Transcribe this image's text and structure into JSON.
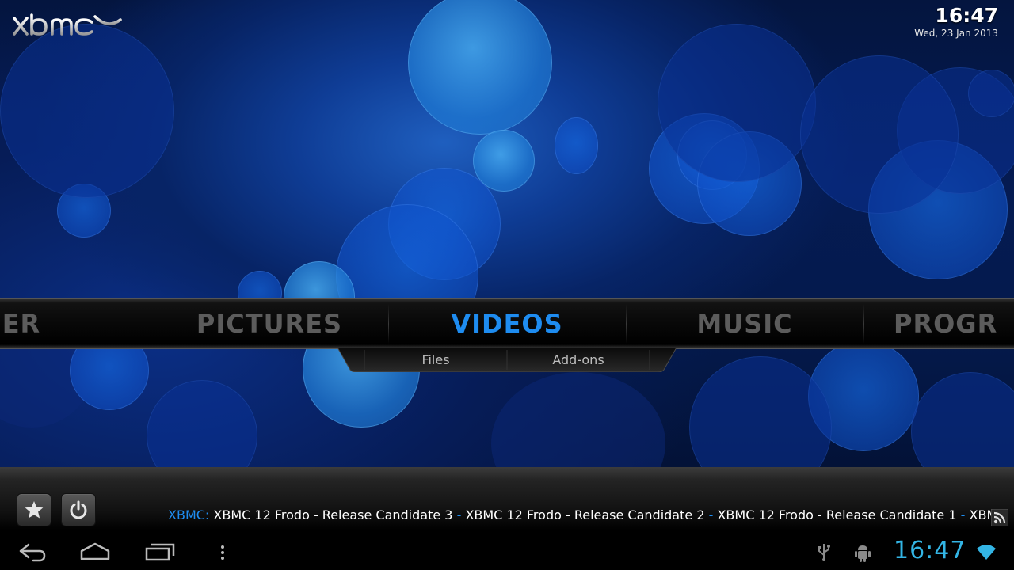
{
  "app": {
    "logo_text": "xbmc"
  },
  "header": {
    "time": "16:47",
    "date": "Wed, 23 Jan 2013"
  },
  "main_menu": {
    "items": [
      "ATHER",
      "PICTURES",
      "VIDEOS",
      "MUSIC",
      "PROGR"
    ],
    "selected": "VIDEOS"
  },
  "submenu": {
    "items": [
      "Files",
      "Add-ons"
    ]
  },
  "footer": {
    "favourites_icon": "star-icon",
    "power_icon": "power-icon",
    "ticker_label": "XBMC:",
    "ticker_items": [
      "XBMC 12 Frodo - Release Candidate 3",
      "XBMC 12 Frodo - Release Candidate 2",
      "XBMC 12 Frodo - Release Candidate 1",
      "XBMC"
    ],
    "ticker_separator": "-",
    "rss_icon": "rss-icon"
  },
  "system_bar": {
    "buttons": [
      "back-icon",
      "home-icon",
      "recent-apps-icon",
      "menu-icon"
    ],
    "status_icons": [
      "usb-icon",
      "android-debug-icon",
      "wifi-icon"
    ],
    "time": "16:47"
  },
  "colors": {
    "accent": "#1e8cf0",
    "android_accent": "#33b5e5",
    "inactive_menu": "#5c5c5c"
  }
}
